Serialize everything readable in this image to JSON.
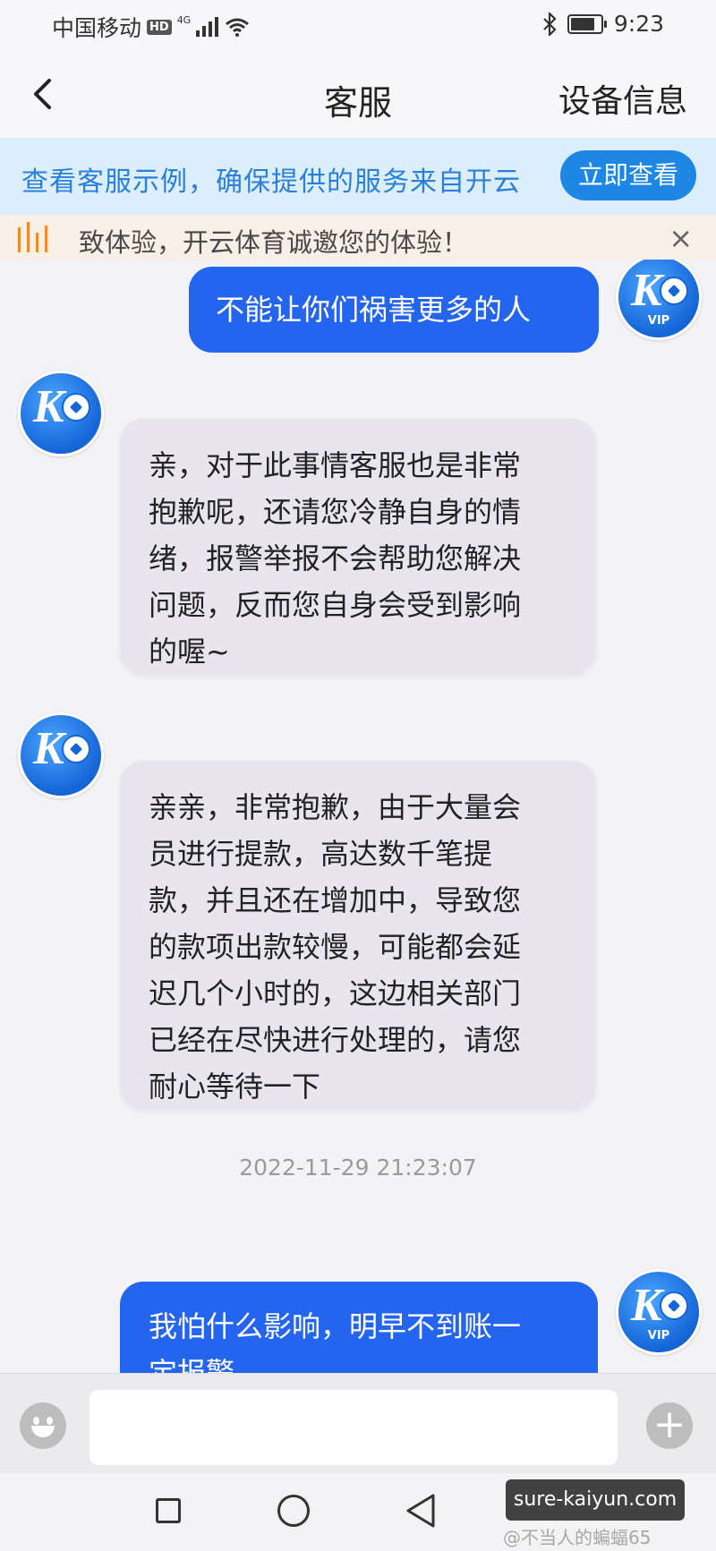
{
  "status_bar": {
    "carrier": "中国移动",
    "hd": "HD",
    "network": "4G",
    "time": "9:23"
  },
  "header": {
    "title": "客服",
    "right_label": "设备信息"
  },
  "banner": {
    "text": "查看客服示例，确保提供的服务来自开云",
    "button_label": "立即查看"
  },
  "notice": {
    "text": "致体验，开云体育诚邀您的体验！",
    "close_symbol": "×"
  },
  "chat": {
    "messages": [
      {
        "sender": "user",
        "text": "不能让你们祸害更多的人"
      },
      {
        "sender": "agent",
        "lines": [
          "亲，对于此事情客服也是非常",
          "抱歉呢，还请您冷静自身的情",
          "绪，报警举报不会帮助您解决",
          "问题，反而您自身会受到影响",
          "的喔~"
        ]
      },
      {
        "sender": "agent",
        "lines": [
          "亲亲，非常抱歉，由于大量会",
          "员进行提款，高达数千笔提",
          "款，并且还在增加中，导致您",
          "的款项出款较慢，可能都会延",
          "迟几个小时的，这边相关部门",
          "已经在尽快进行处理的，请您",
          "耐心等待一下"
        ]
      },
      {
        "sender": "user",
        "lines": [
          "我怕什么影响，明早不到账一",
          "定报警"
        ]
      }
    ],
    "timestamp": "2022-11-29 21:23:07",
    "vip_label": "VIP"
  },
  "input_bar": {
    "value": "",
    "plus_symbol": "+"
  },
  "watermark": {
    "site": "sure-kaiyun.com",
    "author": "@不当人的蝙蝠65"
  },
  "colors": {
    "accent": "#1e86e3",
    "user_bubble": "#2465ef",
    "agent_bubble": "#e9e5ef",
    "banner_bg": "#dbeefc",
    "notice_bg": "#f8efe6"
  }
}
